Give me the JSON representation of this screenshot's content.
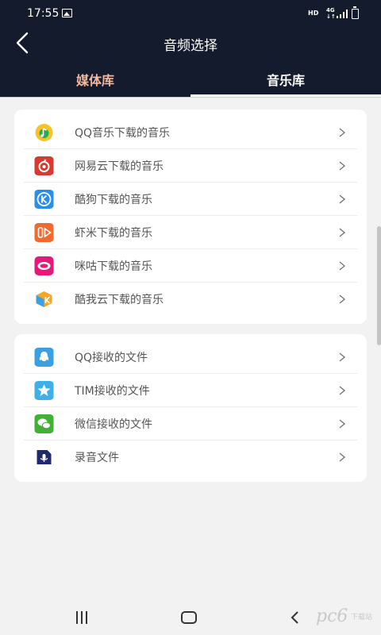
{
  "status_bar": {
    "time": "17:55",
    "hd_label": "HD",
    "network_label": "4G",
    "network_sub": "↓↑"
  },
  "header": {
    "title": "音频选择",
    "tabs": [
      {
        "label": "媒体库",
        "active": false,
        "color": "#f2b8a0"
      },
      {
        "label": "音乐库",
        "active": true,
        "color": "#ffffff"
      }
    ]
  },
  "music_sources": [
    {
      "label": "QQ音乐下载的音乐",
      "icon": "qq-music-icon",
      "color": "#f7c325"
    },
    {
      "label": "网易云下载的音乐",
      "icon": "netease-cloud-music-icon",
      "color": "#d93a2f"
    },
    {
      "label": "酷狗下载的音乐",
      "icon": "kugou-icon",
      "color": "#2b8ee8"
    },
    {
      "label": "虾米下载的音乐",
      "icon": "xiami-icon",
      "color": "#f26a2e"
    },
    {
      "label": "咪咕下载的音乐",
      "icon": "migu-icon",
      "color": "#e5197a"
    },
    {
      "label": "酷我云下载的音乐",
      "icon": "kuwo-icon",
      "color": "#f5a623"
    }
  ],
  "file_sources": [
    {
      "label": "QQ接收的文件",
      "icon": "qq-icon",
      "color": "#3aa0e0"
    },
    {
      "label": "TIM接收的文件",
      "icon": "tim-icon",
      "color": "#3fb0e6"
    },
    {
      "label": "微信接收的文件",
      "icon": "wechat-icon",
      "color": "#41b035"
    },
    {
      "label": "录音文件",
      "icon": "recorder-icon",
      "color": "#1e2a6e"
    }
  ],
  "watermark": {
    "text": "pc6",
    "sub_label": "下载站"
  }
}
